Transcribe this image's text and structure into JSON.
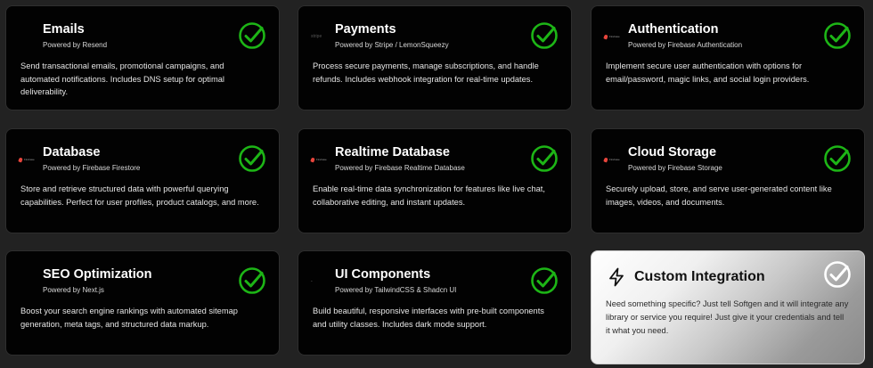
{
  "colors": {
    "accent_green": "#1db516",
    "card_bg": "#020202",
    "page_bg": "#222222"
  },
  "cards": [
    {
      "title": "Emails",
      "powered_by": "Powered by Resend",
      "description": "Send transactional emails, promotional campaigns, and automated notifications. Includes DNS setup for optimal deliverability.",
      "logo": "resend-logo",
      "checked": true
    },
    {
      "title": "Payments",
      "powered_by": "Powered by Stripe / LemonSqueezy",
      "description": "Process secure payments, manage subscriptions, and handle refunds. Includes webhook integration for real-time updates.",
      "logo": "stripe-logo",
      "logo_text": "stripe",
      "checked": true
    },
    {
      "title": "Authentication",
      "powered_by": "Powered by Firebase Authentication",
      "description": "Implement secure user authentication with options for email/password, magic links, and social login providers.",
      "logo": "firebase-logo",
      "logo_text": "Firebase",
      "checked": true
    },
    {
      "title": "Database",
      "powered_by": "Powered by Firebase Firestore",
      "description": "Store and retrieve structured data with powerful querying capabilities. Perfect for user profiles, product catalogs, and more.",
      "logo": "firebase-logo",
      "logo_text": "Firebase",
      "checked": true
    },
    {
      "title": "Realtime Database",
      "powered_by": "Powered by Firebase Realtime Database",
      "description": "Enable real-time data synchronization for features like live chat, collaborative editing, and instant updates.",
      "logo": "firebase-logo",
      "logo_text": "Firebase",
      "checked": true
    },
    {
      "title": "Cloud Storage",
      "powered_by": "Powered by Firebase Storage",
      "description": "Securely upload, store, and serve user-generated content like images, videos, and documents.",
      "logo": "firebase-logo",
      "logo_text": "Firebase",
      "checked": true
    },
    {
      "title": "SEO Optimization",
      "powered_by": "Powered by Next.js",
      "description": "Boost your search engine rankings with automated sitemap generation, meta tags, and structured data markup.",
      "logo": "nextjs-logo",
      "checked": true
    },
    {
      "title": "UI Components",
      "powered_by": "Powered by TailwindCSS & Shadcn UI",
      "description": "Build beautiful, responsive interfaces with pre-built components and utility classes. Includes dark mode support.",
      "logo": "shadcn-logo",
      "logo_text": "-",
      "checked": true
    }
  ],
  "custom": {
    "title": "Custom Integration",
    "description": "Need something specific? Just tell Softgen and it will integrate any library or service you require! Just give it your credentials and tell it what you need.",
    "icon": "lightning-bolt-icon",
    "checked": true
  }
}
